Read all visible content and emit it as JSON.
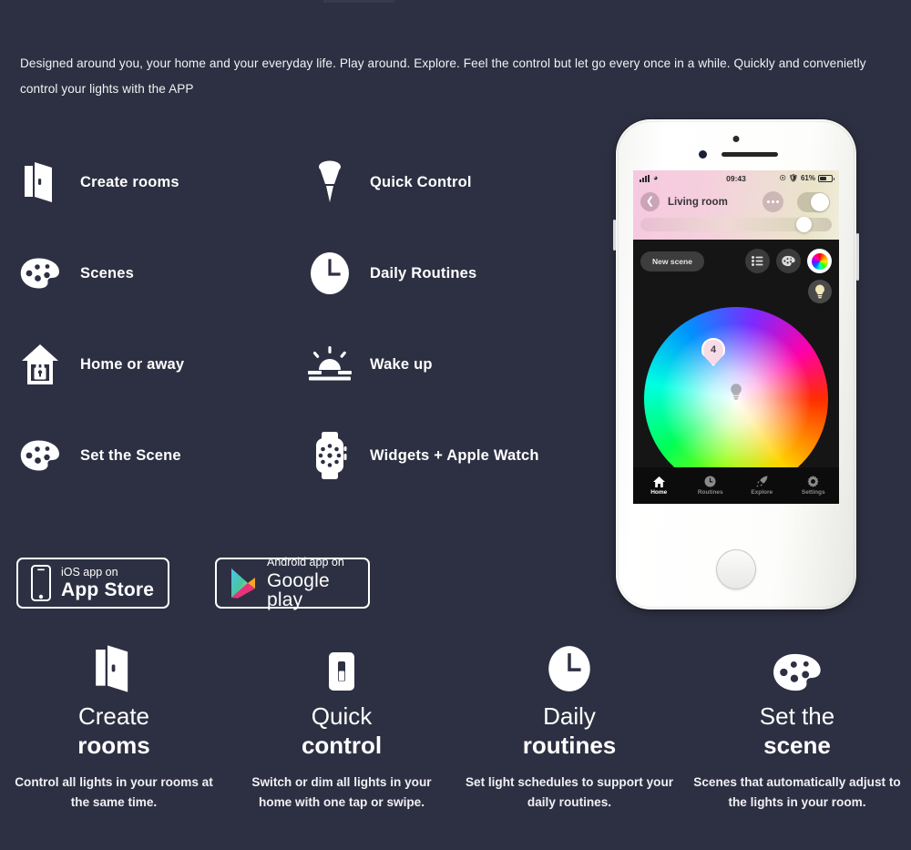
{
  "intro": {
    "text": "Designed around you, your home and your everyday life. Play around. Explore. Feel the control but let go every once in a while. Quickly and convenietly control your lights with the  APP"
  },
  "features": [
    {
      "label": "Create rooms",
      "icon": "open-door-icon"
    },
    {
      "label": "Quick Control",
      "icon": "spotlight-bulb-icon"
    },
    {
      "label": "Scenes",
      "icon": "palette-icon"
    },
    {
      "label": "Daily Routines",
      "icon": "clock-icon"
    },
    {
      "label": "Home or away",
      "icon": "house-lock-icon"
    },
    {
      "label": "Wake up",
      "icon": "sunrise-icon"
    },
    {
      "label": "Set the Scene",
      "icon": "palette-icon"
    },
    {
      "label": "Widgets + Apple Watch",
      "icon": "apple-watch-icon"
    }
  ],
  "badges": {
    "ios": {
      "small": "iOS app on",
      "big": "App Store",
      "icon": "iphone-icon"
    },
    "android": {
      "small": "Android app on",
      "big": "Google play",
      "icon": "google-play-triangle-icon"
    }
  },
  "bottom_cards": [
    {
      "icon": "open-door-icon",
      "title_line1": "Create",
      "title_line2": "rooms",
      "desc": "Control all lights in your rooms at the same time."
    },
    {
      "icon": "light-switch-icon",
      "title_line1": "Quick",
      "title_line2": "control",
      "desc": "Switch or dim all lights in your home with one tap or swipe."
    },
    {
      "icon": "clock-icon",
      "title_line1": "Daily",
      "title_line2": "routines",
      "desc": "Set light schedules to support your daily routines."
    },
    {
      "icon": "palette-icon",
      "title_line1": "Set the",
      "title_line2": "scene",
      "desc": "Scenes that automatically adjust to the lights in your room."
    }
  ],
  "phone": {
    "status_bar": {
      "time": "09:43",
      "battery_percent": "61%",
      "signal_icon": "cellular-bars-icon",
      "wifi_icon": "wifi-icon",
      "battery_icon": "battery-icon",
      "lock_icon": "rotation-lock-icon",
      "shield_icon": "shield-icon"
    },
    "header": {
      "room_name": "Living room",
      "back_icon": "chevron-left-icon",
      "more_icon": "more-dots-icon",
      "power_toggle": "on"
    },
    "toolbar": {
      "new_scene_label": "New scene",
      "list_icon": "list-icon",
      "palette_icon": "palette-icon",
      "color_wheel_icon": "color-wheel-icon",
      "bulb_icon": "bulb-icon"
    },
    "color_wheel": {
      "marker_label": "4",
      "center_icon": "bulb-icon"
    },
    "nav": [
      {
        "label": "Home",
        "icon": "home-icon",
        "active": true
      },
      {
        "label": "Routines",
        "icon": "clock-icon",
        "active": false
      },
      {
        "label": "Explore",
        "icon": "rocket-icon",
        "active": false
      },
      {
        "label": "Settings",
        "icon": "gear-icon",
        "active": false
      }
    ]
  },
  "colors": {
    "background": "#2d3042",
    "text": "#ffffff",
    "phone_body": "#f7f7f5",
    "screen_dark": "#151515"
  }
}
